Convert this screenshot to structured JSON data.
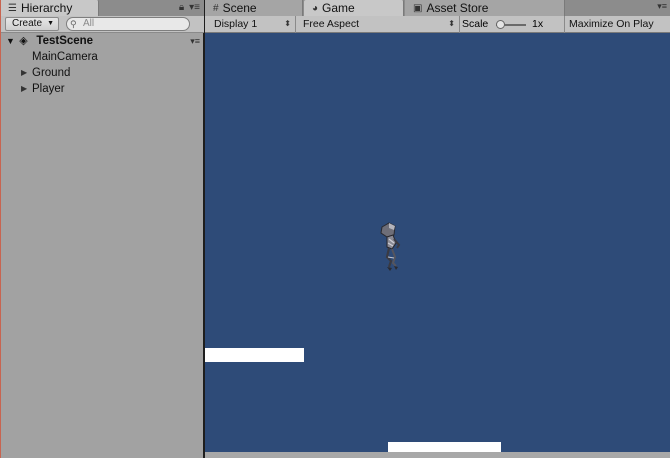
{
  "hierarchy": {
    "tab_label": "Hierarchy",
    "create_label": "Create",
    "search_placeholder": "All",
    "scene_name": "TestScene",
    "children": [
      {
        "label": "MainCamera",
        "expandable": false
      },
      {
        "label": "Ground",
        "expandable": true
      },
      {
        "label": "Player",
        "expandable": true
      }
    ]
  },
  "game": {
    "tabs": [
      {
        "label": "Scene",
        "icon": "grid-icon"
      },
      {
        "label": "Game",
        "icon": "pacman-icon",
        "active": true
      },
      {
        "label": "Asset Store",
        "icon": "store-bag-icon"
      }
    ],
    "toolbar": {
      "display": "Display 1",
      "aspect": "Free Aspect",
      "scale_label": "Scale",
      "scale_value": "1x",
      "maximize_label": "Maximize On Play"
    },
    "view": {
      "background_color": "#2e4b78",
      "platform_color": "#ffffff"
    }
  }
}
